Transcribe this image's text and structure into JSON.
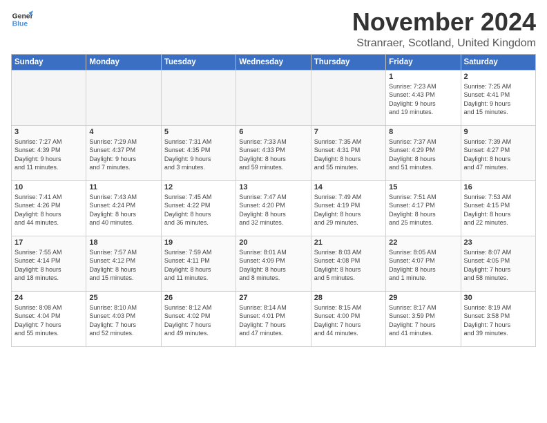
{
  "logo": {
    "line1": "General",
    "line2": "Blue"
  },
  "title": "November 2024",
  "subtitle": "Stranraer, Scotland, United Kingdom",
  "days_of_week": [
    "Sunday",
    "Monday",
    "Tuesday",
    "Wednesday",
    "Thursday",
    "Friday",
    "Saturday"
  ],
  "weeks": [
    [
      {
        "day": "",
        "info": ""
      },
      {
        "day": "",
        "info": ""
      },
      {
        "day": "",
        "info": ""
      },
      {
        "day": "",
        "info": ""
      },
      {
        "day": "",
        "info": ""
      },
      {
        "day": "1",
        "info": "Sunrise: 7:23 AM\nSunset: 4:43 PM\nDaylight: 9 hours\nand 19 minutes."
      },
      {
        "day": "2",
        "info": "Sunrise: 7:25 AM\nSunset: 4:41 PM\nDaylight: 9 hours\nand 15 minutes."
      }
    ],
    [
      {
        "day": "3",
        "info": "Sunrise: 7:27 AM\nSunset: 4:39 PM\nDaylight: 9 hours\nand 11 minutes."
      },
      {
        "day": "4",
        "info": "Sunrise: 7:29 AM\nSunset: 4:37 PM\nDaylight: 9 hours\nand 7 minutes."
      },
      {
        "day": "5",
        "info": "Sunrise: 7:31 AM\nSunset: 4:35 PM\nDaylight: 9 hours\nand 3 minutes."
      },
      {
        "day": "6",
        "info": "Sunrise: 7:33 AM\nSunset: 4:33 PM\nDaylight: 8 hours\nand 59 minutes."
      },
      {
        "day": "7",
        "info": "Sunrise: 7:35 AM\nSunset: 4:31 PM\nDaylight: 8 hours\nand 55 minutes."
      },
      {
        "day": "8",
        "info": "Sunrise: 7:37 AM\nSunset: 4:29 PM\nDaylight: 8 hours\nand 51 minutes."
      },
      {
        "day": "9",
        "info": "Sunrise: 7:39 AM\nSunset: 4:27 PM\nDaylight: 8 hours\nand 47 minutes."
      }
    ],
    [
      {
        "day": "10",
        "info": "Sunrise: 7:41 AM\nSunset: 4:26 PM\nDaylight: 8 hours\nand 44 minutes."
      },
      {
        "day": "11",
        "info": "Sunrise: 7:43 AM\nSunset: 4:24 PM\nDaylight: 8 hours\nand 40 minutes."
      },
      {
        "day": "12",
        "info": "Sunrise: 7:45 AM\nSunset: 4:22 PM\nDaylight: 8 hours\nand 36 minutes."
      },
      {
        "day": "13",
        "info": "Sunrise: 7:47 AM\nSunset: 4:20 PM\nDaylight: 8 hours\nand 32 minutes."
      },
      {
        "day": "14",
        "info": "Sunrise: 7:49 AM\nSunset: 4:19 PM\nDaylight: 8 hours\nand 29 minutes."
      },
      {
        "day": "15",
        "info": "Sunrise: 7:51 AM\nSunset: 4:17 PM\nDaylight: 8 hours\nand 25 minutes."
      },
      {
        "day": "16",
        "info": "Sunrise: 7:53 AM\nSunset: 4:15 PM\nDaylight: 8 hours\nand 22 minutes."
      }
    ],
    [
      {
        "day": "17",
        "info": "Sunrise: 7:55 AM\nSunset: 4:14 PM\nDaylight: 8 hours\nand 18 minutes."
      },
      {
        "day": "18",
        "info": "Sunrise: 7:57 AM\nSunset: 4:12 PM\nDaylight: 8 hours\nand 15 minutes."
      },
      {
        "day": "19",
        "info": "Sunrise: 7:59 AM\nSunset: 4:11 PM\nDaylight: 8 hours\nand 11 minutes."
      },
      {
        "day": "20",
        "info": "Sunrise: 8:01 AM\nSunset: 4:09 PM\nDaylight: 8 hours\nand 8 minutes."
      },
      {
        "day": "21",
        "info": "Sunrise: 8:03 AM\nSunset: 4:08 PM\nDaylight: 8 hours\nand 5 minutes."
      },
      {
        "day": "22",
        "info": "Sunrise: 8:05 AM\nSunset: 4:07 PM\nDaylight: 8 hours\nand 1 minute."
      },
      {
        "day": "23",
        "info": "Sunrise: 8:07 AM\nSunset: 4:05 PM\nDaylight: 7 hours\nand 58 minutes."
      }
    ],
    [
      {
        "day": "24",
        "info": "Sunrise: 8:08 AM\nSunset: 4:04 PM\nDaylight: 7 hours\nand 55 minutes."
      },
      {
        "day": "25",
        "info": "Sunrise: 8:10 AM\nSunset: 4:03 PM\nDaylight: 7 hours\nand 52 minutes."
      },
      {
        "day": "26",
        "info": "Sunrise: 8:12 AM\nSunset: 4:02 PM\nDaylight: 7 hours\nand 49 minutes."
      },
      {
        "day": "27",
        "info": "Sunrise: 8:14 AM\nSunset: 4:01 PM\nDaylight: 7 hours\nand 47 minutes."
      },
      {
        "day": "28",
        "info": "Sunrise: 8:15 AM\nSunset: 4:00 PM\nDaylight: 7 hours\nand 44 minutes."
      },
      {
        "day": "29",
        "info": "Sunrise: 8:17 AM\nSunset: 3:59 PM\nDaylight: 7 hours\nand 41 minutes."
      },
      {
        "day": "30",
        "info": "Sunrise: 8:19 AM\nSunset: 3:58 PM\nDaylight: 7 hours\nand 39 minutes."
      }
    ]
  ]
}
